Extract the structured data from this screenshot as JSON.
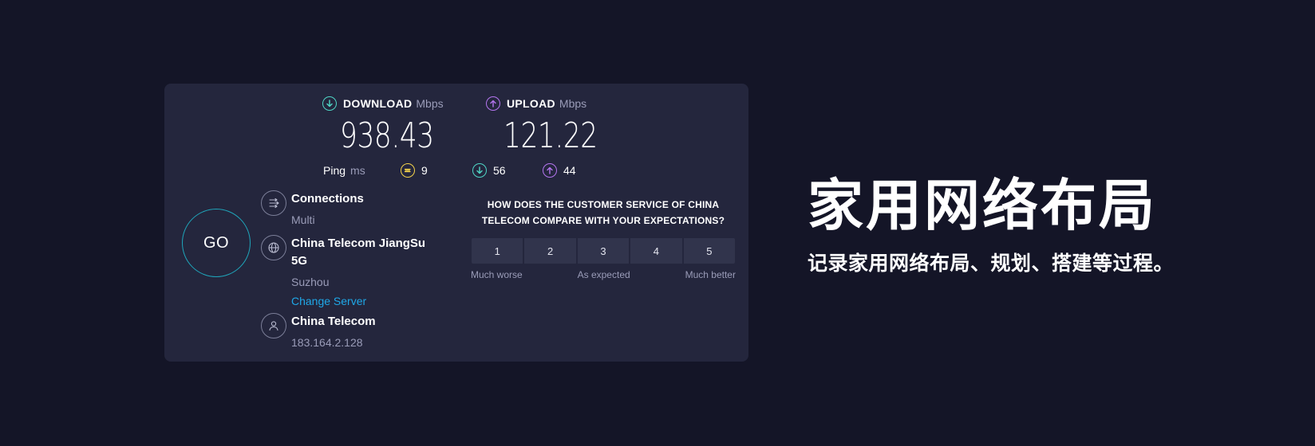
{
  "results": {
    "download": {
      "label": "DOWNLOAD",
      "unit": "Mbps",
      "value": "938.43",
      "color": "#4fd6c6"
    },
    "upload": {
      "label": "UPLOAD",
      "unit": "Mbps",
      "value": "121.22",
      "color": "#b475ef"
    }
  },
  "ping": {
    "label": "Ping",
    "unit": "ms",
    "idle": {
      "value": "9",
      "color": "#f5d34a"
    },
    "download": {
      "value": "56",
      "color": "#4fd6c6"
    },
    "upload": {
      "value": "44",
      "color": "#b475ef"
    }
  },
  "go_button": {
    "label": "GO"
  },
  "connections": {
    "title": "Connections",
    "value": "Multi"
  },
  "server": {
    "title": "China Telecom JiangSu 5G",
    "location": "Suzhou",
    "change_link": "Change Server"
  },
  "provider": {
    "title": "China Telecom",
    "ip": "183.164.2.128"
  },
  "survey": {
    "question": "HOW DOES THE CUSTOMER SERVICE OF CHINA TELECOM COMPARE WITH YOUR EXPECTATIONS?",
    "options": [
      "1",
      "2",
      "3",
      "4",
      "5"
    ],
    "label_low": "Much worse",
    "label_mid": "As expected",
    "label_high": "Much better"
  },
  "banner": {
    "title": "家用网络布局",
    "subtitle": "记录家用网络布局、规划、搭建等过程。"
  },
  "icons": {
    "download": "arrow-down-circle-icon",
    "upload": "arrow-up-circle-icon",
    "idle_ping": "wave-circle-icon",
    "connections": "connections-icon",
    "server": "globe-icon",
    "provider": "user-icon"
  }
}
